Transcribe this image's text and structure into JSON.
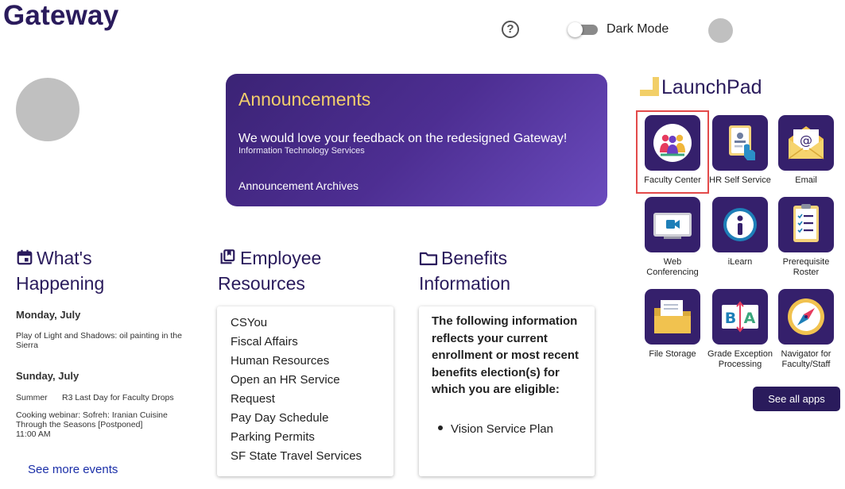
{
  "header": {
    "logo": "Gateway",
    "help_symbol": "?",
    "dark_mode_label": "Dark Mode",
    "dark_mode_on": false
  },
  "announcements": {
    "title": "Announcements",
    "message": "We would love your feedback on the redesigned Gateway!",
    "source": "Information Technology Services",
    "archives_link": "Announcement Archives"
  },
  "whats_happening": {
    "title_line1": "What's",
    "title_line2": "Happening",
    "events": [
      {
        "date": "Monday, July",
        "text": "Play of Light and Shadows: oil painting in the Sierra"
      },
      {
        "date": "Sunday, July",
        "category": "Summer",
        "text": "R3 Last Day for Faculty Drops"
      },
      {
        "text": "Cooking webinar: Sofreh: Iranian Cuisine Through the Seasons [Postponed]",
        "time": "11:00 AM"
      }
    ],
    "see_more": "See more events"
  },
  "employee_resources": {
    "title_line1": "Employee",
    "title_line2": "Resources",
    "items": [
      "CSYou",
      "Fiscal Affairs",
      "Human Resources",
      "Open an HR Service",
      "Request",
      "Pay Day Schedule",
      "Parking Permits",
      "SF State Travel Services"
    ]
  },
  "benefits_information": {
    "title_line1": "Benefits",
    "title_line2": "Information",
    "text": "The following information reflects your current enrollment or most recent benefits election(s) for which you are eligible:",
    "items": [
      "Vision Service Plan"
    ]
  },
  "launchpad": {
    "title": "LaunchPad",
    "apps": [
      {
        "label": "Faculty Center",
        "icon": "people-group-icon",
        "selected": true
      },
      {
        "label": "HR Self Service",
        "icon": "id-badge-hand-icon"
      },
      {
        "label": "Email",
        "icon": "envelope-icon"
      },
      {
        "label": "Web Conferencing",
        "icon": "video-camera-icon"
      },
      {
        "label": "iLearn",
        "icon": "info-circle-icon"
      },
      {
        "label": "Prerequisite Roster",
        "icon": "checklist-icon"
      },
      {
        "label": "File Storage",
        "icon": "folder-icon"
      },
      {
        "label": "Grade Exception Processing",
        "icon": "b-a-grade-icon"
      },
      {
        "label": "Navigator for Faculty/Staff",
        "icon": "compass-icon"
      }
    ],
    "see_all": "See all apps"
  },
  "colors": {
    "brand": "#2a1b5c",
    "announcement_title": "#f3cf6c",
    "link": "#1a2ea8",
    "selected_outline": "#e34a4a"
  }
}
